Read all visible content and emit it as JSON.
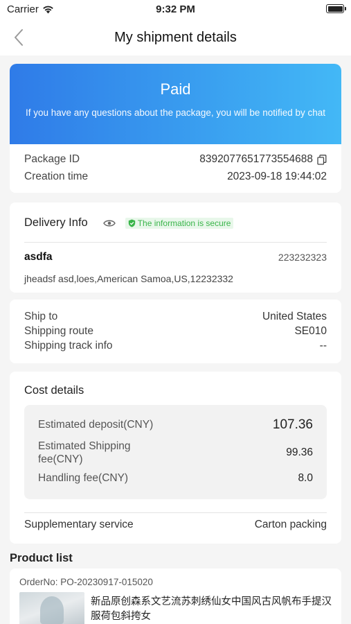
{
  "status_bar": {
    "carrier": "Carrier",
    "time": "9:32 PM"
  },
  "nav": {
    "title": "My shipment details"
  },
  "hero": {
    "status": "Paid",
    "message": "If you have any questions about the package, you will be notified by chat"
  },
  "package": {
    "id_label": "Package ID",
    "id_value": "8392077651773554688",
    "created_label": "Creation time",
    "created_value": "2023-09-18 19:44:02"
  },
  "delivery": {
    "title": "Delivery Info",
    "secure_text": "The information is secure",
    "name": "asdfa",
    "phone": "223232323",
    "address": "jheadsf asd,loes,American Samoa,US,12232332"
  },
  "shipping": {
    "ship_to_label": "Ship to",
    "ship_to_value": "United States",
    "route_label": "Shipping route",
    "route_value": "SE010",
    "track_label": "Shipping track info",
    "track_value": "--"
  },
  "cost": {
    "title": "Cost details",
    "deposit_label": "Estimated deposit(CNY)",
    "deposit_value": "107.36",
    "shipping_fee_label": "Estimated Shipping fee(CNY)",
    "shipping_fee_value": "99.36",
    "handling_label": "Handling fee(CNY)",
    "handling_value": "8.0",
    "supplementary_label": "Supplementary service",
    "supplementary_value": "Carton packing"
  },
  "products": {
    "title": "Product list",
    "order_no": "OrderNo: PO-20230917-015020",
    "item_name": "新品原创森系文艺流苏刺绣仙女中国风古风帆布手提汉服荷包斜挎女"
  },
  "colors": {
    "hero_gradient_start": "#2f7be8",
    "hero_gradient_end": "#43b8f6",
    "secure_green": "#3ab54a"
  }
}
